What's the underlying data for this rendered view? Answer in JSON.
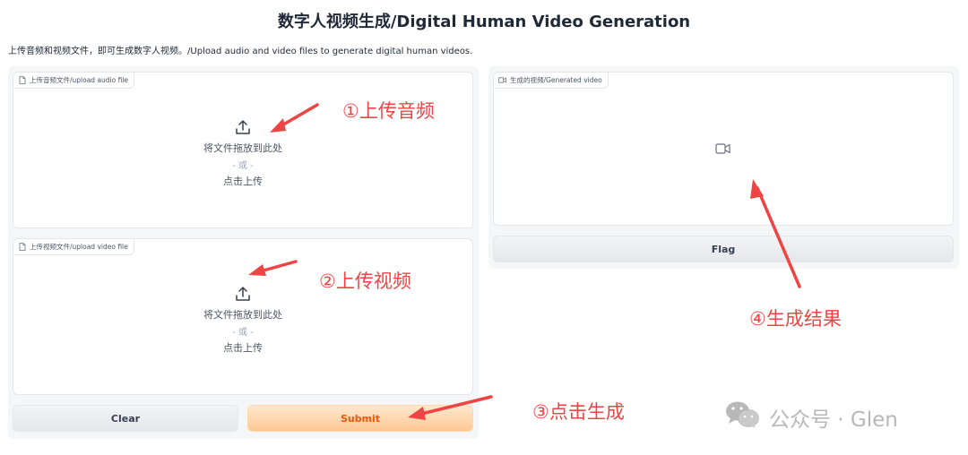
{
  "page": {
    "title": "数字人视频生成/Digital Human Video Generation",
    "description": "上传音频和视频文件，即可生成数字人视频。/Upload audio and video files to generate digital human videos."
  },
  "inputs": {
    "audio": {
      "label": "上传音频文件/upload audio file",
      "drop_text": "将文件拖放到此处",
      "or_text": "- 或 -",
      "click_text": "点击上传"
    },
    "video": {
      "label": "上传视频文件/upload video file",
      "drop_text": "将文件拖放到此处",
      "or_text": "- 或 -",
      "click_text": "点击上传"
    }
  },
  "output": {
    "label": "生成的视频/Generated video"
  },
  "buttons": {
    "clear": "Clear",
    "submit": "Submit",
    "flag": "Flag"
  },
  "annotations": {
    "step1": "①上传音频",
    "step2": "②上传视频",
    "step3": "③点击生成",
    "step4": "④生成结果"
  },
  "watermark": {
    "text": "公众号 · Glen",
    "icon": "wechat-icon"
  },
  "colors": {
    "annotation": "#ef4444",
    "submit_text": "#ea580c",
    "submit_bg": "#fdc894"
  }
}
